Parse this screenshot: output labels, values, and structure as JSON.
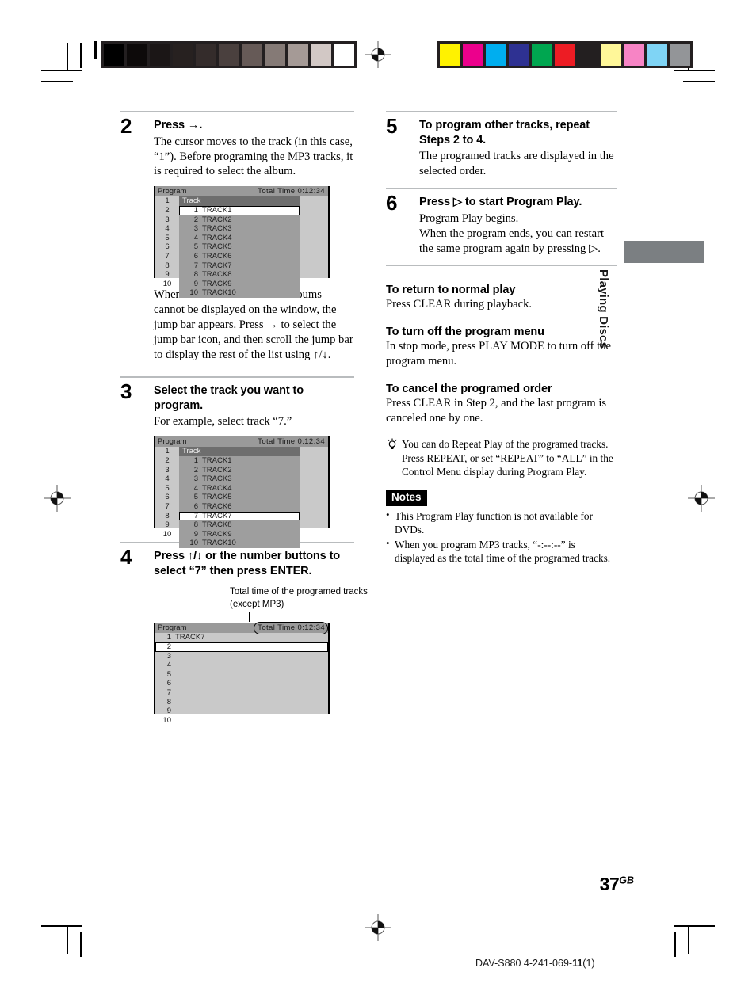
{
  "print_marks": {
    "grayscale_strip": {
      "name": "grayscale-calibration-strip",
      "swatches": [
        "#000000",
        "#0d0a0a",
        "#1b1616",
        "#272120",
        "#342c2b",
        "#4a403e",
        "#665a57",
        "#857a76",
        "#a59a96",
        "#d2c8c5",
        "#ffffff"
      ]
    },
    "color_strip": {
      "name": "color-calibration-strip",
      "swatches": [
        "#fff200",
        "#ec008c",
        "#00aeef",
        "#2e3192",
        "#00a650",
        "#ed1c24",
        "#231f20",
        "#fff799",
        "#f784c5",
        "#7fd4f5",
        "#939598"
      ]
    }
  },
  "left_column": {
    "steps": [
      {
        "number": "2",
        "title": "Press →.",
        "body": "The cursor moves to the track (in this case, “1”). Before programing the MP3 tracks, it is required to select the album.",
        "screen": "screen_step2",
        "after_note": "When the list of all tracks or albums cannot be displayed on the window, the jump bar appears. Press → to select the jump bar icon, and then scroll the jump bar to display the rest of the list using ↑/↓."
      },
      {
        "number": "3",
        "title": "Select the track you want to program.",
        "body": "For example, select track “7.”",
        "screen": "screen_step3"
      },
      {
        "number": "4",
        "title": "Press ↑/↓ or the number buttons to select “7” then press ENTER.",
        "body": "",
        "screen": "screen_step4",
        "callout": "Total time of the programed tracks (except MP3)"
      }
    ]
  },
  "right_column": {
    "steps": [
      {
        "number": "5",
        "title": "To program other tracks, repeat Steps 2 to 4.",
        "body": "The programed tracks are displayed in the selected order."
      },
      {
        "number": "6",
        "title": "Press ▷ to start Program Play.",
        "body": "Program Play begins.\nWhen the program ends, you can restart the same program again by pressing ▷."
      }
    ],
    "sections": [
      {
        "heading": "To return to normal play",
        "body": "Press CLEAR during playback."
      },
      {
        "heading": "To turn off the program menu",
        "body": "In stop mode, press PLAY MODE to turn off the program menu."
      },
      {
        "heading": "To cancel the programed order",
        "body": "Press CLEAR in Step 2, and the last program is canceled one by one."
      }
    ],
    "tip": {
      "icon": "lightbulb-icon",
      "text": "You can do Repeat Play of the programed tracks. Press REPEAT, or set “REPEAT” to “ALL” in the Control Menu display during Program Play."
    },
    "notes": {
      "badge": "Notes",
      "items": [
        "This Program Play function is not available for DVDs.",
        "When you program MP3 tracks, “-:--:--” is displayed as the total time of the programed tracks."
      ]
    }
  },
  "osd_screens": {
    "screen_step2": {
      "title_left": "Program",
      "title_right": "Total  Time  0:12:34",
      "program_numbers": [
        "1",
        "2",
        "3",
        "4",
        "5",
        "6",
        "7",
        "8",
        "9",
        "10"
      ],
      "track_header": "Track",
      "tracks": [
        {
          "num": "1",
          "name": "TRACK1"
        },
        {
          "num": "2",
          "name": "TRACK2"
        },
        {
          "num": "3",
          "name": "TRACK3"
        },
        {
          "num": "4",
          "name": "TRACK4"
        },
        {
          "num": "5",
          "name": "TRACK5"
        },
        {
          "num": "6",
          "name": "TRACK6"
        },
        {
          "num": "7",
          "name": "TRACK7"
        },
        {
          "num": "8",
          "name": "TRACK8"
        },
        {
          "num": "9",
          "name": "TRACK9"
        },
        {
          "num": "10",
          "name": "TRACK10"
        }
      ],
      "selected_index": 0
    },
    "screen_step3": {
      "title_left": "Program",
      "title_right": "Total  Time  0:12:34",
      "program_numbers": [
        "1",
        "2",
        "3",
        "4",
        "5",
        "6",
        "7",
        "8",
        "9",
        "10"
      ],
      "track_header": "Track",
      "tracks": [
        {
          "num": "1",
          "name": "TRACK1"
        },
        {
          "num": "2",
          "name": "TRACK2"
        },
        {
          "num": "3",
          "name": "TRACK3"
        },
        {
          "num": "4",
          "name": "TRACK4"
        },
        {
          "num": "5",
          "name": "TRACK5"
        },
        {
          "num": "6",
          "name": "TRACK6"
        },
        {
          "num": "7",
          "name": "TRACK7"
        },
        {
          "num": "8",
          "name": "TRACK8"
        },
        {
          "num": "9",
          "name": "TRACK9"
        },
        {
          "num": "10",
          "name": "TRACK10"
        }
      ],
      "selected_index": 6
    },
    "screen_step4": {
      "title_left": "Program",
      "title_right": "Total  Time  0:12:34",
      "rows": [
        {
          "num": "1",
          "name": "TRACK7"
        },
        {
          "num": "2",
          "name": ""
        },
        {
          "num": "3",
          "name": ""
        },
        {
          "num": "4",
          "name": ""
        },
        {
          "num": "5",
          "name": ""
        },
        {
          "num": "6",
          "name": ""
        },
        {
          "num": "7",
          "name": ""
        },
        {
          "num": "8",
          "name": ""
        },
        {
          "num": "9",
          "name": ""
        },
        {
          "num": "10",
          "name": ""
        }
      ],
      "selected_index": 1
    }
  },
  "side_tab": {
    "label": "Playing Discs"
  },
  "footer": {
    "page_number": "37",
    "page_suffix": "GB",
    "imprint_prefix": "DAV-S880 4-241-069-",
    "imprint_bold": "11",
    "imprint_suffix": "(1)"
  }
}
